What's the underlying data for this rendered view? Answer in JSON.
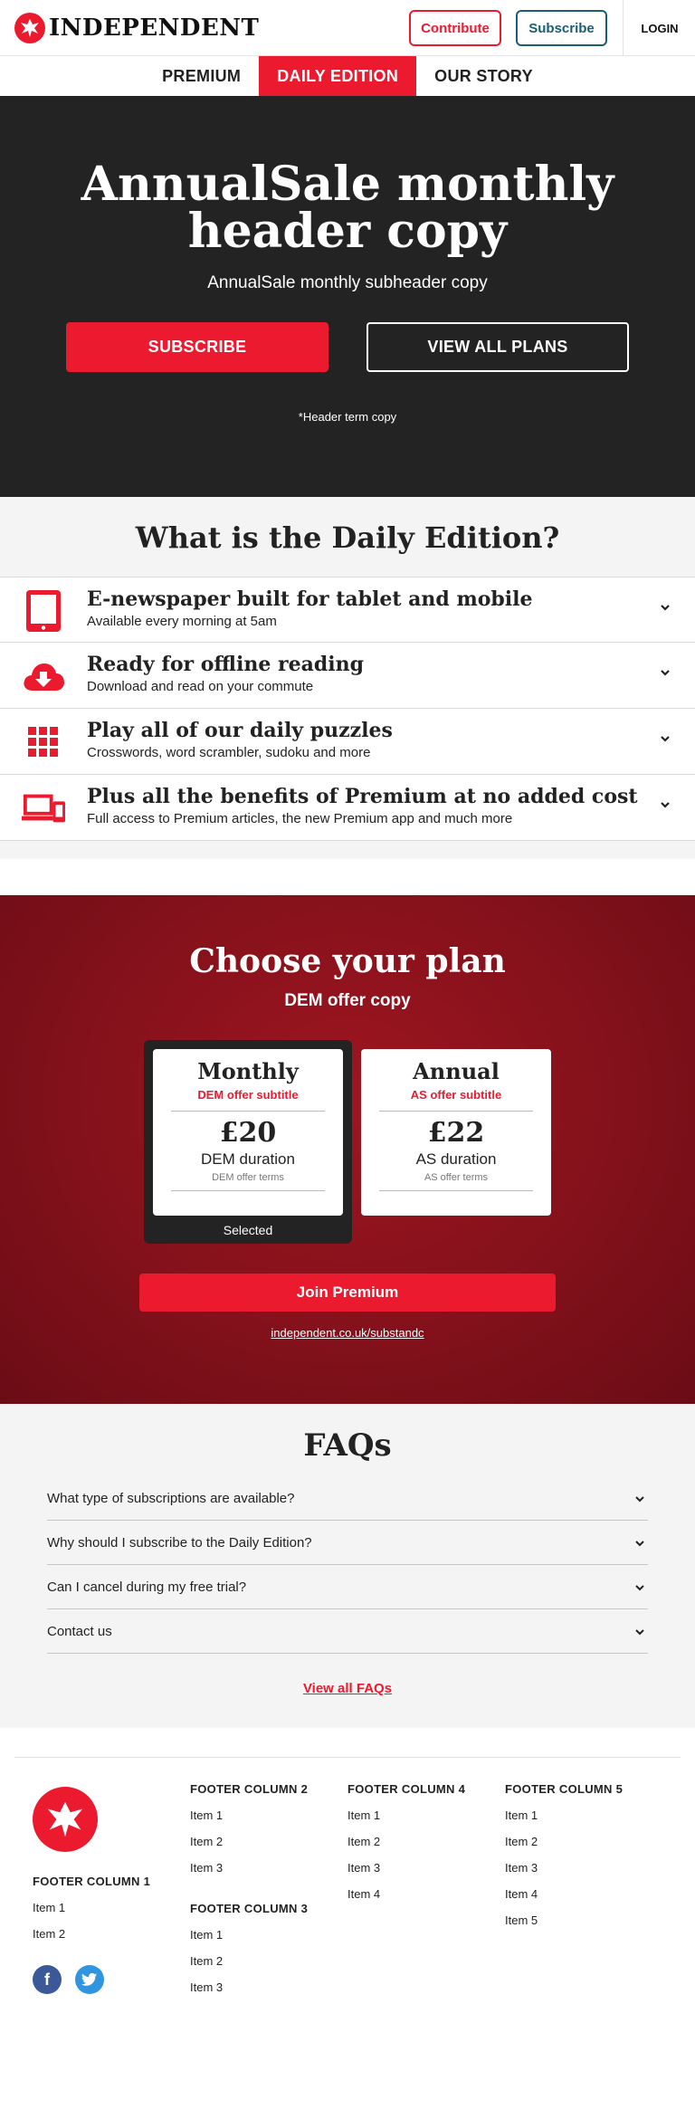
{
  "header": {
    "logo_text": "INDEPENDENT",
    "contribute_label": "Contribute",
    "subscribe_label": "Subscribe",
    "login_label": "LOGIN"
  },
  "nav": {
    "tabs": [
      {
        "label": "PREMIUM",
        "active": false
      },
      {
        "label": "DAILY EDITION",
        "active": true
      },
      {
        "label": "OUR STORY",
        "active": false
      }
    ]
  },
  "hero": {
    "title": "AnnualSale monthly header copy",
    "subtitle": "AnnualSale monthly subheader copy",
    "subscribe_label": "SUBSCRIBE",
    "view_plans_label": "VIEW ALL PLANS",
    "terms": "*Header term copy"
  },
  "whatis": {
    "title": "What is the Daily Edition?",
    "features": [
      {
        "title": "E-newspaper built for tablet and mobile",
        "desc": "Available every morning at 5am",
        "icon": "tablet-icon"
      },
      {
        "title": "Ready for offline reading",
        "desc": "Download and read on your commute",
        "icon": "cloud-download-icon"
      },
      {
        "title": "Play all of our daily puzzles",
        "desc": "Crosswords, word scrambler, sudoku and more",
        "icon": "puzzle-grid-icon"
      },
      {
        "title": "Plus all the benefits of Premium at no added cost",
        "desc": "Full access to Premium articles, the new Premium app and much more",
        "icon": "devices-icon"
      }
    ]
  },
  "plans": {
    "title": "Choose your plan",
    "offer": "DEM offer copy",
    "monthly": {
      "name": "Monthly",
      "subtitle": "DEM offer subtitle",
      "price": "£20",
      "duration": "DEM duration",
      "terms": "DEM offer terms",
      "selected_label": "Selected"
    },
    "annual": {
      "name": "Annual",
      "subtitle": "AS offer subtitle",
      "price": "£22",
      "duration": "AS duration",
      "terms": "AS offer terms"
    },
    "join_label": "Join Premium",
    "link": "independent.co.uk/substandc"
  },
  "faqs": {
    "title": "FAQs",
    "items": [
      "What type of subscriptions are available?",
      "Why should I subscribe to the Daily Edition?",
      "Can I cancel during my free trial?",
      "Contact us"
    ],
    "view_all": "View all FAQs"
  },
  "footer": {
    "col1": {
      "title": "FOOTER COLUMN 1",
      "items": [
        "Item 1",
        "Item 2"
      ]
    },
    "col2": {
      "title": "FOOTER COLUMN 2",
      "items": [
        "Item 1",
        "Item 2",
        "Item 3"
      ]
    },
    "col3": {
      "title": "FOOTER COLUMN 3",
      "items": [
        "Item 1",
        "Item 2",
        "Item 3"
      ]
    },
    "col4": {
      "title": "FOOTER COLUMN 4",
      "items": [
        "Item 1",
        "Item 2",
        "Item 3",
        "Item 4"
      ]
    },
    "col5": {
      "title": "FOOTER COLUMN 5",
      "items": [
        "Item 1",
        "Item 2",
        "Item 3",
        "Item 4",
        "Item 5"
      ]
    },
    "social": [
      "facebook-icon",
      "twitter-icon"
    ]
  },
  "colors": {
    "brand_red": "#ec1a2e",
    "subscribe_teal": "#1a5e73",
    "hero_bg": "#232323",
    "plans_bg": "#8a121c"
  }
}
